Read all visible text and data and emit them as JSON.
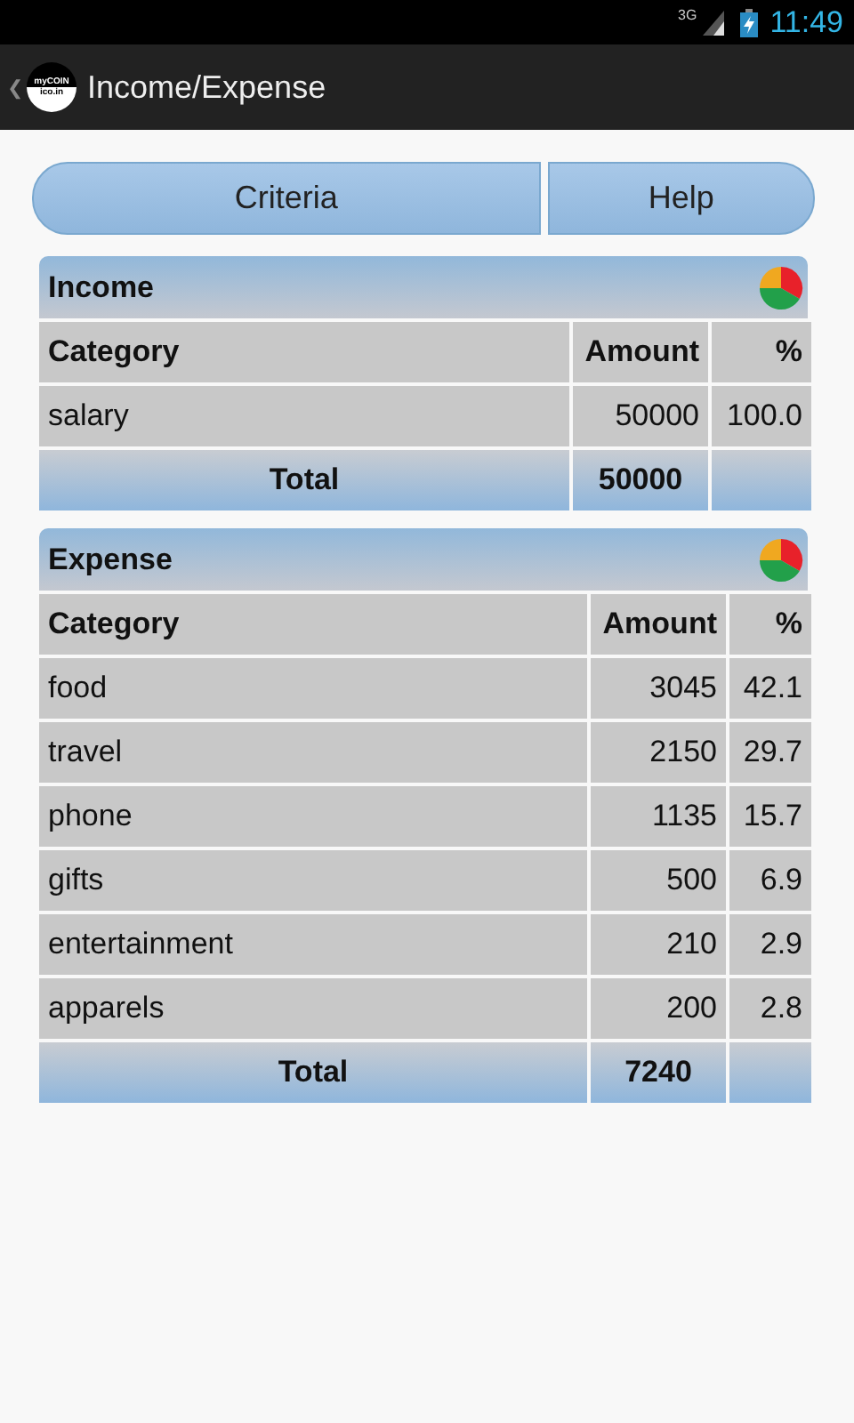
{
  "status_bar": {
    "network": "3G",
    "time": "11:49"
  },
  "app_bar": {
    "back": "❮",
    "logo_lines": [
      "myCOIN",
      "ico.in"
    ],
    "title": "Income/Expense"
  },
  "buttons": [
    "Criteria",
    "Help"
  ],
  "sections": [
    {
      "title": "Income",
      "columns": [
        "Category",
        "Amount",
        "%"
      ],
      "rows": [
        [
          "salary",
          "50000",
          "100.0"
        ]
      ],
      "total": {
        "label": "Total",
        "amount": "50000"
      }
    },
    {
      "title": "Expense",
      "columns": [
        "Category",
        "Amount",
        "%"
      ],
      "rows": [
        [
          "food",
          "3045",
          "42.1"
        ],
        [
          "travel",
          "2150",
          "29.7"
        ],
        [
          "phone",
          "1135",
          "15.7"
        ],
        [
          "gifts",
          "500",
          "6.9"
        ],
        [
          "entertainment",
          "210",
          "2.9"
        ],
        [
          "apparels",
          "200",
          "2.8"
        ]
      ],
      "total": {
        "label": "Total",
        "amount": "7240"
      }
    }
  ]
}
